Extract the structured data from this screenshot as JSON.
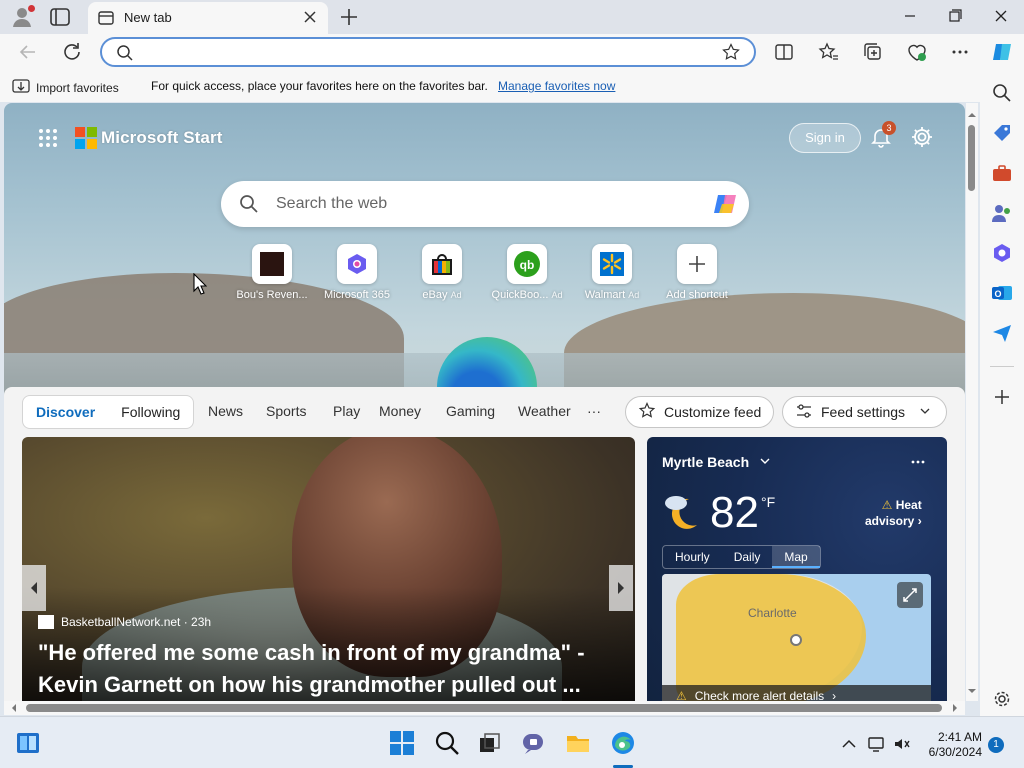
{
  "browser": {
    "tab_title": "New tab",
    "address_value": "",
    "favorites_bar": {
      "import_label": "Import favorites",
      "message": "For quick access, place your favorites here on the favorites bar.",
      "manage_link": "Manage favorites now"
    }
  },
  "start_page": {
    "brand": "Microsoft Start",
    "sign_in": "Sign in",
    "notification_count": "3",
    "search_placeholder": "Search the web",
    "shortcuts": [
      {
        "label": "Bou's Reven...",
        "ad": ""
      },
      {
        "label": "Microsoft 365",
        "ad": ""
      },
      {
        "label": "eBay",
        "ad": "Ad"
      },
      {
        "label": "QuickBoo...",
        "ad": "Ad"
      },
      {
        "label": "Walmart",
        "ad": "Ad"
      },
      {
        "label": "Add shortcut",
        "ad": ""
      }
    ],
    "feed_tabs": {
      "discover": "Discover",
      "following": "Following",
      "links": [
        "News",
        "Sports",
        "Play",
        "Money",
        "Gaming",
        "Weather"
      ],
      "more": "···",
      "customize": "Customize feed",
      "settings": "Feed settings"
    },
    "hero": {
      "source": "BasketballNetwork.net · 23h",
      "headline": "\"He offered me some cash in front of my grandma\" - Kevin Garnett on how his grandmother pulled out ..."
    },
    "weather": {
      "location": "Myrtle Beach",
      "temperature": "82",
      "unit": "°F",
      "advisory_line1": "Heat",
      "advisory_line2": "advisory",
      "tabs": [
        "Hourly",
        "Daily",
        "Map"
      ],
      "active_tab": "Map",
      "map_city": "Charlotte",
      "alert_text": "Check more alert details"
    }
  },
  "taskbar": {
    "time": "2:41 AM",
    "date": "6/30/2024",
    "notification_count": "1"
  },
  "colors": {
    "accent": "#0f6cbd",
    "address_border": "#5b8fd6",
    "badge": "#c8512b",
    "heat_advisory": "#f0c23a"
  }
}
